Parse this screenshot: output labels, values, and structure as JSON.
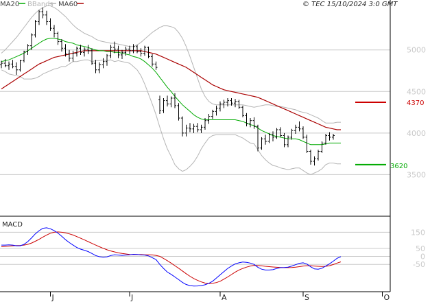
{
  "copyright": "© TEC 15/10/2024 3:0 GMT",
  "colors": {
    "price": "#000000",
    "ma20": "#00aa00",
    "bbands": "#b4b4b4",
    "ma60": "#aa0000",
    "resistance": "#cc0000",
    "support": "#00aa00",
    "macd": "#0000ff",
    "signal": "#cc0000",
    "grid": "#c8c8c8"
  },
  "legend": [
    {
      "label": "MA20",
      "color": "#00aa00",
      "text_color": "#444444"
    },
    {
      "label": "BBands",
      "color": "#b4b4b4",
      "text_color": "#b4b4b4"
    },
    {
      "label": "MA60",
      "color": "#aa0000",
      "text_color": "#444444"
    }
  ],
  "levels": [
    {
      "label": "4370",
      "value": 4370,
      "color": "#cc0000"
    },
    {
      "label": "3620",
      "value": 3620,
      "color": "#00aa00"
    }
  ],
  "chart_data": [
    {
      "type": "ohlc",
      "ylim": [
        3000,
        5600
      ],
      "yticks": [
        {
          "label": "5000",
          "value": 5000
        },
        {
          "label": "4500",
          "value": 4500
        },
        {
          "label": "4000",
          "value": 4000
        },
        {
          "label": "3500",
          "value": 3500
        }
      ],
      "x_tick_labels": [
        "J",
        "J",
        "A",
        "S",
        "O"
      ],
      "x_tick_index": [
        13,
        34,
        58,
        80,
        101
      ],
      "ohlc": [
        [
          4820,
          4870,
          4780,
          4840
        ],
        [
          4840,
          4890,
          4790,
          4810
        ],
        [
          4810,
          4860,
          4760,
          4830
        ],
        [
          4830,
          4880,
          4780,
          4800
        ],
        [
          4800,
          4850,
          4700,
          4760
        ],
        [
          4760,
          4880,
          4740,
          4870
        ],
        [
          4870,
          4990,
          4850,
          4980
        ],
        [
          4980,
          5070,
          4940,
          5050
        ],
        [
          5050,
          5200,
          5000,
          5180
        ],
        [
          5180,
          5360,
          5150,
          5340
        ],
        [
          5340,
          5480,
          5300,
          5460
        ],
        [
          5460,
          5510,
          5380,
          5420
        ],
        [
          5420,
          5470,
          5300,
          5340
        ],
        [
          5340,
          5380,
          5230,
          5260
        ],
        [
          5260,
          5300,
          5150,
          5200
        ],
        [
          5200,
          5220,
          5060,
          5100
        ],
        [
          5100,
          5130,
          4980,
          5020
        ],
        [
          5020,
          5070,
          4920,
          4950
        ],
        [
          4950,
          5000,
          4860,
          4900
        ],
        [
          4900,
          4990,
          4860,
          4960
        ],
        [
          4960,
          5040,
          4920,
          5020
        ],
        [
          5020,
          5060,
          4940,
          4970
        ],
        [
          4970,
          5030,
          4920,
          5010
        ],
        [
          5010,
          5060,
          4950,
          4990
        ],
        [
          4990,
          5020,
          4820,
          4840
        ],
        [
          4840,
          4880,
          4720,
          4760
        ],
        [
          4760,
          4850,
          4720,
          4820
        ],
        [
          4820,
          4900,
          4780,
          4860
        ],
        [
          4860,
          4950,
          4810,
          4930
        ],
        [
          4930,
          5060,
          4900,
          5030
        ],
        [
          5030,
          5100,
          4960,
          5010
        ],
        [
          5010,
          5050,
          4900,
          4940
        ],
        [
          4940,
          5000,
          4890,
          4970
        ],
        [
          4970,
          5040,
          4930,
          5010
        ],
        [
          5010,
          5050,
          4950,
          4990
        ],
        [
          4990,
          5070,
          4960,
          5040
        ],
        [
          5040,
          5060,
          4960,
          4980
        ],
        [
          4980,
          5020,
          4920,
          4960
        ],
        [
          4960,
          5050,
          4930,
          5030
        ],
        [
          5030,
          5040,
          4900,
          4920
        ],
        [
          4920,
          4950,
          4800,
          4830
        ],
        [
          4830,
          4860,
          4760,
          4790
        ],
        [
          4400,
          4450,
          4230,
          4270
        ],
        [
          4270,
          4420,
          4240,
          4390
        ],
        [
          4390,
          4450,
          4320,
          4350
        ],
        [
          4350,
          4440,
          4310,
          4420
        ],
        [
          4420,
          4480,
          4300,
          4330
        ],
        [
          4330,
          4360,
          4150,
          4180
        ],
        [
          4180,
          4200,
          3960,
          4000
        ],
        [
          4000,
          4100,
          3960,
          4060
        ],
        [
          4060,
          4120,
          4010,
          4050
        ],
        [
          4050,
          4110,
          4000,
          4080
        ],
        [
          4080,
          4120,
          4010,
          4040
        ],
        [
          4040,
          4100,
          4000,
          4070
        ],
        [
          4070,
          4180,
          4040,
          4150
        ],
        [
          4150,
          4230,
          4110,
          4200
        ],
        [
          4200,
          4280,
          4170,
          4260
        ],
        [
          4260,
          4330,
          4210,
          4300
        ],
        [
          4300,
          4380,
          4260,
          4350
        ],
        [
          4350,
          4400,
          4300,
          4370
        ],
        [
          4370,
          4420,
          4320,
          4390
        ],
        [
          4390,
          4420,
          4330,
          4360
        ],
        [
          4360,
          4410,
          4310,
          4380
        ],
        [
          4380,
          4400,
          4290,
          4310
        ],
        [
          4310,
          4330,
          4190,
          4210
        ],
        [
          4210,
          4240,
          4080,
          4110
        ],
        [
          4110,
          4180,
          4070,
          4150
        ],
        [
          4150,
          4190,
          4050,
          4080
        ],
        [
          4080,
          4100,
          3780,
          3820
        ],
        [
          3820,
          3950,
          3800,
          3930
        ],
        [
          3930,
          3980,
          3860,
          3900
        ],
        [
          3900,
          4000,
          3880,
          3980
        ],
        [
          3980,
          4020,
          3900,
          3950
        ],
        [
          3950,
          4060,
          3930,
          4040
        ],
        [
          4040,
          4070,
          3950,
          3970
        ],
        [
          3970,
          4000,
          3830,
          3860
        ],
        [
          3860,
          3970,
          3830,
          3950
        ],
        [
          3950,
          4050,
          3920,
          4030
        ],
        [
          4030,
          4100,
          3990,
          4070
        ],
        [
          4070,
          4140,
          4020,
          4050
        ],
        [
          4050,
          4080,
          3930,
          3950
        ],
        [
          3950,
          3980,
          3760,
          3780
        ],
        [
          3780,
          3800,
          3620,
          3660
        ],
        [
          3660,
          3720,
          3610,
          3690
        ],
        [
          3690,
          3800,
          3670,
          3780
        ],
        [
          3780,
          3900,
          3760,
          3880
        ],
        [
          3880,
          3990,
          3860,
          3970
        ],
        [
          3970,
          4010,
          3910,
          3950
        ],
        [
          3950,
          3990,
          3920,
          3970
        ]
      ],
      "ma20": [
        4860,
        4870,
        4880,
        4900,
        4920,
        4940,
        4960,
        4990,
        5020,
        5050,
        5080,
        5110,
        5130,
        5140,
        5140,
        5130,
        5120,
        5100,
        5090,
        5080,
        5060,
        5050,
        5040,
        5030,
        5010,
        5000,
        4990,
        4990,
        4980,
        4980,
        4970,
        4970,
        4960,
        4950,
        4940,
        4920,
        4910,
        4890,
        4860,
        4820,
        4780,
        4730,
        4670,
        4610,
        4550,
        4500,
        4440,
        4390,
        4340,
        4300,
        4260,
        4220,
        4190,
        4170,
        4160,
        4160,
        4160,
        4160,
        4160,
        4160,
        4160,
        4160,
        4160,
        4150,
        4140,
        4120,
        4100,
        4090,
        4060,
        4030,
        4010,
        3990,
        3970,
        3960,
        3950,
        3940,
        3930,
        3930,
        3930,
        3920,
        3900,
        3880,
        3860,
        3860,
        3860,
        3860,
        3870,
        3880,
        3880,
        3880,
        3880
      ],
      "bb_upper": [
        4960,
        5000,
        5050,
        5100,
        5150,
        5210,
        5270,
        5330,
        5390,
        5440,
        5480,
        5510,
        5530,
        5530,
        5510,
        5480,
        5440,
        5400,
        5350,
        5300,
        5260,
        5230,
        5200,
        5180,
        5160,
        5130,
        5110,
        5100,
        5090,
        5080,
        5080,
        5070,
        5060,
        5050,
        5040,
        5040,
        5060,
        5090,
        5130,
        5170,
        5210,
        5240,
        5270,
        5290,
        5290,
        5280,
        5260,
        5210,
        5140,
        5040,
        4920,
        4790,
        4660,
        4530,
        4440,
        4380,
        4350,
        4340,
        4340,
        4340,
        4340,
        4340,
        4340,
        4340,
        4340,
        4330,
        4320,
        4310,
        4320,
        4330,
        4340,
        4340,
        4330,
        4320,
        4320,
        4310,
        4300,
        4290,
        4280,
        4260,
        4250,
        4240,
        4220,
        4200,
        4180,
        4150,
        4120,
        4120,
        4120,
        4130,
        4130
      ],
      "bb_lower": [
        4760,
        4740,
        4710,
        4700,
        4690,
        4680,
        4650,
        4650,
        4650,
        4660,
        4680,
        4710,
        4730,
        4750,
        4770,
        4780,
        4800,
        4800,
        4830,
        4860,
        4860,
        4870,
        4880,
        4880,
        4860,
        4870,
        4870,
        4880,
        4870,
        4880,
        4860,
        4870,
        4860,
        4850,
        4840,
        4800,
        4760,
        4690,
        4590,
        4470,
        4350,
        4220,
        4070,
        3930,
        3810,
        3720,
        3620,
        3570,
        3540,
        3560,
        3600,
        3650,
        3720,
        3810,
        3880,
        3940,
        3970,
        3980,
        3980,
        3980,
        3980,
        3980,
        3980,
        3960,
        3940,
        3910,
        3880,
        3870,
        3800,
        3730,
        3680,
        3640,
        3610,
        3600,
        3580,
        3570,
        3560,
        3570,
        3580,
        3580,
        3550,
        3520,
        3500,
        3520,
        3540,
        3570,
        3620,
        3640,
        3640,
        3630,
        3630
      ],
      "ma60": [
        4530,
        4560,
        4590,
        4620,
        4650,
        4680,
        4710,
        4740,
        4770,
        4800,
        4830,
        4850,
        4870,
        4890,
        4910,
        4920,
        4930,
        4940,
        4950,
        4960,
        4970,
        4980,
        4990,
        4990,
        4990,
        4990,
        4990,
        4990,
        4990,
        4990,
        4990,
        4990,
        4990,
        4990,
        4990,
        4990,
        4990,
        4990,
        4980,
        4970,
        4960,
        4950,
        4930,
        4910,
        4890,
        4870,
        4850,
        4830,
        4810,
        4790,
        4760,
        4730,
        4700,
        4670,
        4640,
        4610,
        4580,
        4560,
        4540,
        4520,
        4510,
        4500,
        4490,
        4480,
        4470,
        4460,
        4450,
        4440,
        4430,
        4410,
        4390,
        4370,
        4350,
        4330,
        4310,
        4290,
        4270,
        4250,
        4230,
        4210,
        4190,
        4170,
        4150,
        4130,
        4110,
        4090,
        4070,
        4060,
        4050,
        4040,
        4040
      ]
    },
    {
      "type": "line",
      "title": "MACD",
      "ylim": [
        -220,
        250
      ],
      "yticks": [
        {
          "label": "150",
          "value": 150
        },
        {
          "label": "50",
          "value": 50
        },
        {
          "label": "0",
          "value": 0
        },
        {
          "label": "-50",
          "value": -50
        }
      ],
      "macd": [
        70,
        70,
        72,
        70,
        66,
        66,
        75,
        92,
        115,
        140,
        160,
        175,
        178,
        172,
        160,
        145,
        125,
        104,
        86,
        70,
        55,
        45,
        38,
        30,
        18,
        5,
        -2,
        -5,
        -3,
        5,
        10,
        8,
        6,
        8,
        10,
        13,
        12,
        9,
        8,
        3,
        -8,
        -20,
        -50,
        -75,
        -98,
        -112,
        -128,
        -145,
        -162,
        -175,
        -182,
        -185,
        -184,
        -182,
        -177,
        -168,
        -155,
        -135,
        -115,
        -95,
        -75,
        -60,
        -47,
        -40,
        -35,
        -37,
        -42,
        -50,
        -68,
        -80,
        -85,
        -85,
        -83,
        -75,
        -70,
        -69,
        -67,
        -60,
        -52,
        -43,
        -40,
        -48,
        -65,
        -78,
        -80,
        -74,
        -60,
        -46,
        -30,
        -12,
        -2
      ],
      "signal": [
        60,
        62,
        64,
        66,
        67,
        68,
        70,
        75,
        83,
        94,
        106,
        120,
        133,
        144,
        150,
        152,
        150,
        146,
        140,
        133,
        123,
        113,
        103,
        92,
        81,
        70,
        60,
        50,
        41,
        34,
        28,
        22,
        18,
        15,
        12,
        11,
        11,
        11,
        10,
        10,
        9,
        6,
        0,
        -13,
        -27,
        -42,
        -58,
        -74,
        -91,
        -108,
        -124,
        -138,
        -149,
        -159,
        -166,
        -169,
        -168,
        -163,
        -155,
        -142,
        -128,
        -113,
        -98,
        -85,
        -75,
        -67,
        -60,
        -56,
        -57,
        -59,
        -62,
        -64,
        -66,
        -68,
        -69,
        -70,
        -70,
        -69,
        -67,
        -64,
        -60,
        -58,
        -58,
        -60,
        -62,
        -63,
        -62,
        -58,
        -51,
        -42,
        -34
      ]
    }
  ]
}
